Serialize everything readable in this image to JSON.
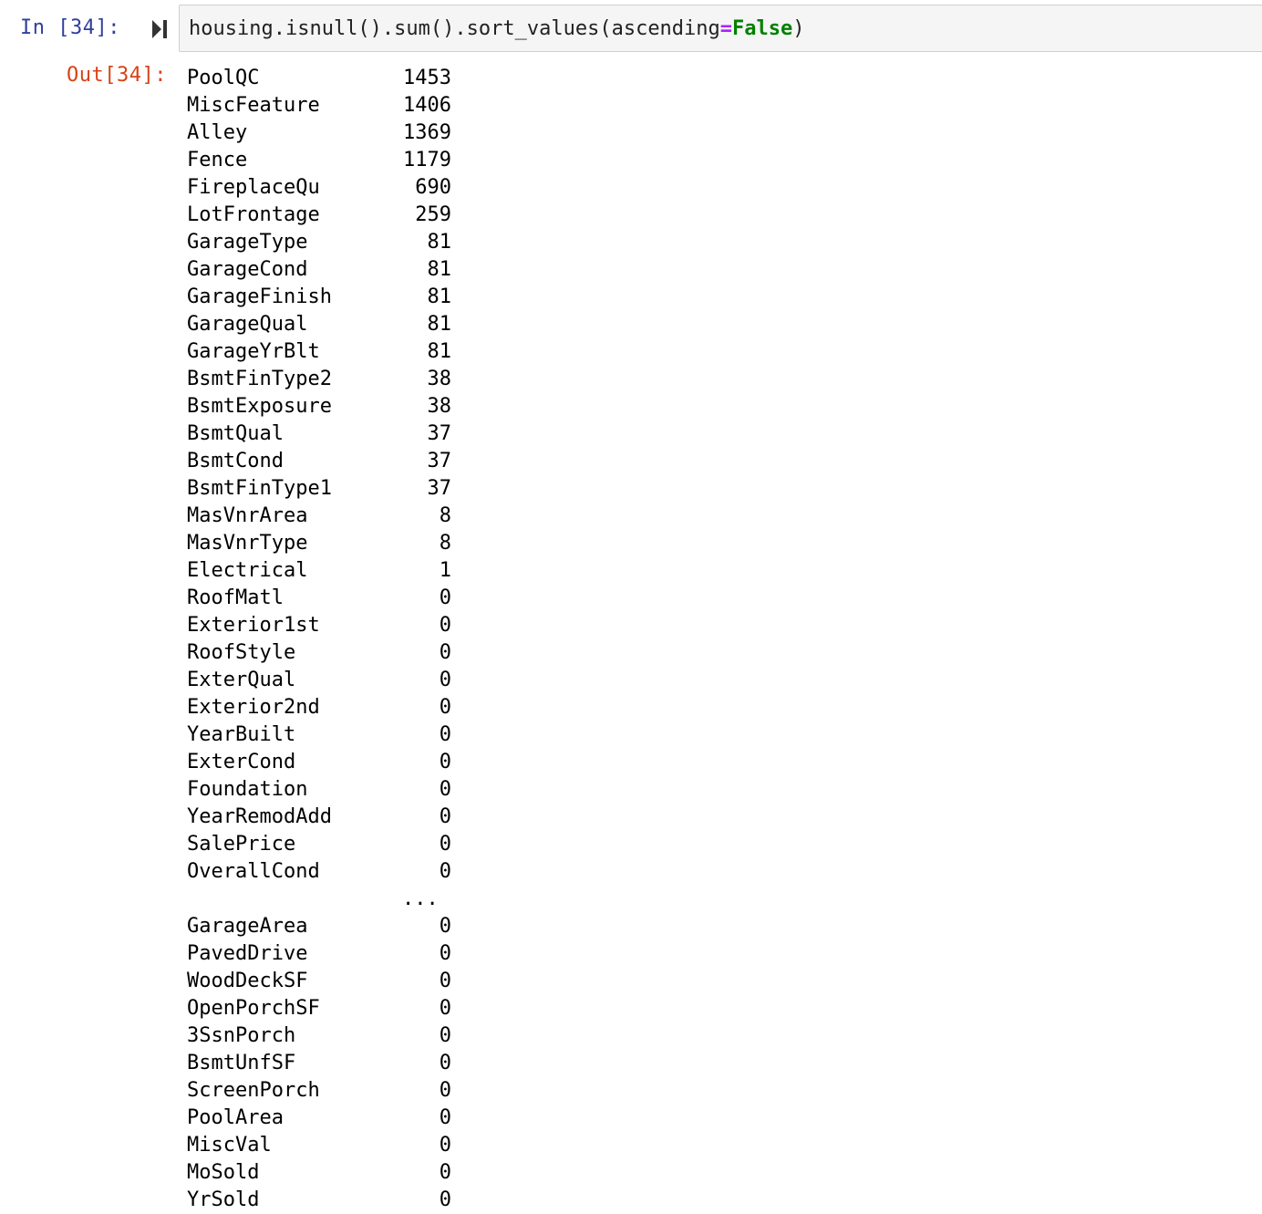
{
  "input_cell": {
    "prompt": "In [34]:",
    "code_prefix": "housing.isnull().sum().sort_values(ascending",
    "code_eq": "=",
    "code_false": "False",
    "code_suffix": ")"
  },
  "output_cell": {
    "prompt": "Out[34]:",
    "rows_top": [
      {
        "name": "PoolQC",
        "value": "1453"
      },
      {
        "name": "MiscFeature",
        "value": "1406"
      },
      {
        "name": "Alley",
        "value": "1369"
      },
      {
        "name": "Fence",
        "value": "1179"
      },
      {
        "name": "FireplaceQu",
        "value": "690"
      },
      {
        "name": "LotFrontage",
        "value": "259"
      },
      {
        "name": "GarageType",
        "value": "81"
      },
      {
        "name": "GarageCond",
        "value": "81"
      },
      {
        "name": "GarageFinish",
        "value": "81"
      },
      {
        "name": "GarageQual",
        "value": "81"
      },
      {
        "name": "GarageYrBlt",
        "value": "81"
      },
      {
        "name": "BsmtFinType2",
        "value": "38"
      },
      {
        "name": "BsmtExposure",
        "value": "38"
      },
      {
        "name": "BsmtQual",
        "value": "37"
      },
      {
        "name": "BsmtCond",
        "value": "37"
      },
      {
        "name": "BsmtFinType1",
        "value": "37"
      },
      {
        "name": "MasVnrArea",
        "value": "8"
      },
      {
        "name": "MasVnrType",
        "value": "8"
      },
      {
        "name": "Electrical",
        "value": "1"
      },
      {
        "name": "RoofMatl",
        "value": "0"
      },
      {
        "name": "Exterior1st",
        "value": "0"
      },
      {
        "name": "RoofStyle",
        "value": "0"
      },
      {
        "name": "ExterQual",
        "value": "0"
      },
      {
        "name": "Exterior2nd",
        "value": "0"
      },
      {
        "name": "YearBuilt",
        "value": "0"
      },
      {
        "name": "ExterCond",
        "value": "0"
      },
      {
        "name": "Foundation",
        "value": "0"
      },
      {
        "name": "YearRemodAdd",
        "value": "0"
      },
      {
        "name": "SalePrice",
        "value": "0"
      },
      {
        "name": "OverallCond",
        "value": "0"
      }
    ],
    "ellipsis": "...",
    "rows_bottom": [
      {
        "name": "GarageArea",
        "value": "0"
      },
      {
        "name": "PavedDrive",
        "value": "0"
      },
      {
        "name": "WoodDeckSF",
        "value": "0"
      },
      {
        "name": "OpenPorchSF",
        "value": "0"
      },
      {
        "name": "3SsnPorch",
        "value": "0"
      },
      {
        "name": "BsmtUnfSF",
        "value": "0"
      },
      {
        "name": "ScreenPorch",
        "value": "0"
      },
      {
        "name": "PoolArea",
        "value": "0"
      },
      {
        "name": "MiscVal",
        "value": "0"
      },
      {
        "name": "MoSold",
        "value": "0"
      },
      {
        "name": "YrSold",
        "value": "0"
      }
    ]
  }
}
